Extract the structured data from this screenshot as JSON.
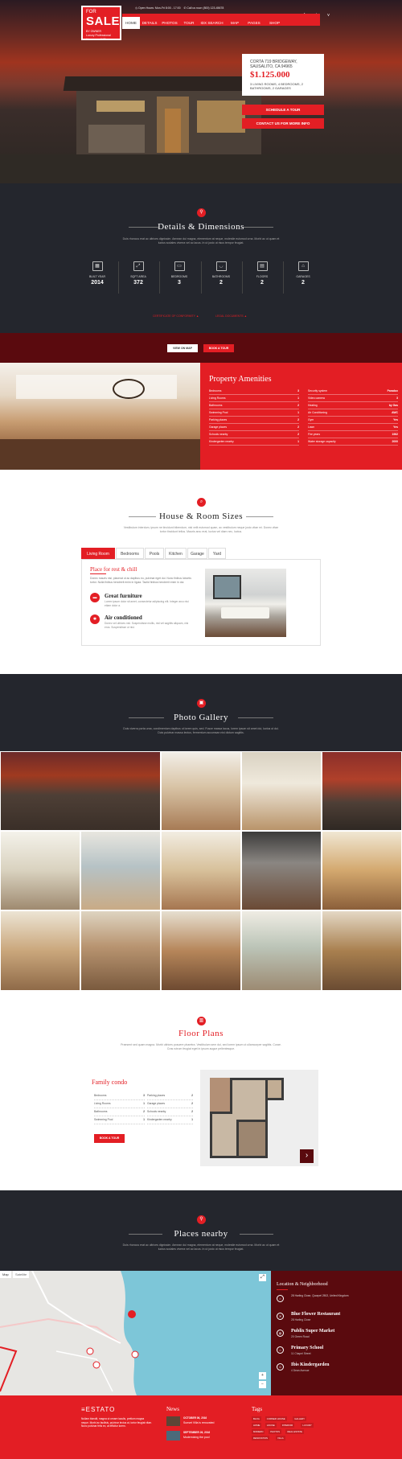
{
  "header": {
    "logo_small": "FOR",
    "logo_big": "SALE",
    "logo_sub": "BY OWNER",
    "logo_tagline": "Luxury Professional Houses and Villas",
    "open_hours": "Open Hours: Mon-Fri 8:00 - 17:00",
    "call_us": "Call us now: (800) 123-45678",
    "social_icons": [
      "facebook-icon",
      "twitter-icon",
      "vimeo-icon"
    ],
    "social_glyphs": [
      "f",
      "t",
      "v"
    ],
    "nav": [
      "HOME",
      "DETAILS",
      "PHOTOS",
      "TOUR",
      "IDX SEARCH",
      "MAP",
      "PAGES",
      "SHOP"
    ]
  },
  "hero": {
    "address": "CORTA 719 BRIDGEWAY, SAUSALITO, CA 94965",
    "price": "$1.125.000",
    "specs": "3 LIVING ROOMS, 4 BEDROOMS, 2 BATHROOMS, 2 GARAGES",
    "schedule_label": "SCHEDULE A TOUR",
    "contact_label": "CONTACT US FOR MORE INFO"
  },
  "details": {
    "title": "Details & Dimensions",
    "subtitle": "Duis rhoncus erat ac ultrices dignissim. Aenean dui magna, elementum at neque, molestie euismod urna. Morbi ac ut quam et luctus sodales viverra vel ac lacus. In ut justo ut risus tempor feugiat.",
    "stats": [
      {
        "label": "BUILT YEAR",
        "value": "2014",
        "icon": "calendar-icon",
        "glyph": "▦"
      },
      {
        "label": "SQFT AREA",
        "value": "372",
        "icon": "area-icon",
        "glyph": "⤢"
      },
      {
        "label": "BEDROOMS",
        "value": "3",
        "icon": "bed-icon",
        "glyph": "▭"
      },
      {
        "label": "BATHROOMS",
        "value": "2",
        "icon": "bath-icon",
        "glyph": "◡"
      },
      {
        "label": "FLOORS",
        "value": "2",
        "icon": "floors-icon",
        "glyph": "▤"
      },
      {
        "label": "GARAGES",
        "value": "2",
        "icon": "garage-icon",
        "glyph": "⌂"
      }
    ],
    "doc1": "CERTIFICATE OF CONFORMITY",
    "doc2": "LEGAL DOCUMENTS",
    "map_btn": "VIEW ON MAP",
    "tour_btn": "BOOK A TOUR"
  },
  "amenities": {
    "title": "Property Amenities",
    "left": [
      {
        "name": "Bedrooms",
        "value": "3"
      },
      {
        "name": "Living Rooms",
        "value": "1"
      },
      {
        "name": "Bathrooms",
        "value": "2"
      },
      {
        "name": "Swimming Pool",
        "value": "1"
      },
      {
        "name": "Parking places",
        "value": "2"
      },
      {
        "name": "Garage places",
        "value": "2"
      },
      {
        "name": "Schools nearby",
        "value": "2"
      },
      {
        "name": "Kindergarten nearby",
        "value": "1"
      }
    ],
    "right": [
      {
        "name": "Security system",
        "value": "Paradox"
      },
      {
        "name": "Video camera",
        "value": "3"
      },
      {
        "name": "Heating",
        "value": "by Gas"
      },
      {
        "name": "Air Conditioning",
        "value": "AWC"
      },
      {
        "name": "Gym",
        "value": "Yes"
      },
      {
        "name": "Lawn",
        "value": "Yes"
      },
      {
        "name": "Fire years",
        "value": "1962"
      },
      {
        "name": "Water storage capacity",
        "value": "2000"
      }
    ]
  },
  "rooms": {
    "title": "House & Room Sizes",
    "subtitle": "Vestibulum interdum, ipsum ne tincidunt bibendum, nisl velit euismod quam, ac vestibulum neque justo vitae mi. Donec vitae tortor tincidunt tellus. Mauris arcu erat, luctus vel diam nec, luctus.",
    "tabs": [
      "Living Room",
      "Bedrooms",
      "Pools",
      "Kitchen",
      "Garage",
      "Yard"
    ],
    "card_title": "Place for rest & chill",
    "card_text": "Donec mauris nisi, placerat ut ac dapibus eu, pulvinar eget dui. Nunc finibus lobortis tortor. Nulla finibus hendrerit enim in ligula. Tactid finibus hendrerit enim in dui.",
    "features": [
      {
        "title": "Great furniture",
        "text": "Lorem ipsum dolor sit amet, consectetur adipiscing elit. Integer arcu nisi etiam dolor a.",
        "icon": "sofa-icon",
        "glyph": "▬"
      },
      {
        "title": "Air conditioned",
        "text": "Donec vel ultrices nisl. Suspendisse mollis, nisl vel sagittis aliquam, nisi eros. Suspendisse ut nisl.",
        "icon": "snowflake-icon",
        "glyph": "✱"
      }
    ]
  },
  "gallery": {
    "title": "Photo Gallery",
    "subtitle": "Duis viverra porta urna, condimentum dapibus ut lorem quis, sed. Fusce massa lacus, lorem ipsum sit amet dui, luctus ut dui. Duis pulvinar massa lectus, fermentum accumsan nisi dictum sagittis."
  },
  "floor": {
    "title": "Floor Plans",
    "subtitle": "Praesent sed quam magna. Morbi ultrices posuere pharetra. Vestibulum sem dui, sed lorem ipsum ut ullamcorper sagittis. Curae. Cras rutrum feugiat eget in ipsum augue pellentesque.",
    "plan_title": "Family condo",
    "left": [
      {
        "name": "Bedrooms",
        "value": "3"
      },
      {
        "name": "Living Rooms",
        "value": "1"
      },
      {
        "name": "Bathrooms",
        "value": "2"
      },
      {
        "name": "Swimming Pool",
        "value": "1"
      }
    ],
    "right": [
      {
        "name": "Parking places",
        "value": "2"
      },
      {
        "name": "Garage places",
        "value": "2"
      },
      {
        "name": "Schools nearby",
        "value": "2"
      },
      {
        "name": "Kindergarten nearby",
        "value": "1"
      }
    ],
    "book_btn": "BOOK A TOUR",
    "next": "›"
  },
  "places": {
    "title": "Places nearby",
    "subtitle": "Duis rhoncus erat ac ultrices dignissim. Aenean dui magna, elementum at neque, molestie euismod urna. Morbi ac ut quam et luctus sodales viverra vel ac lacus. In ut justo ut risus tempor feugiat.",
    "map_tabs": [
      "Map",
      "Satellite"
    ],
    "loc_title": "Location & Neighborhood",
    "home_addr": "28 Harling Close, Quorpel 2502, United Kingdom",
    "items": [
      {
        "name": "Blue Flower Restaurant",
        "addr": "28 Harling Close",
        "icon": "restaurant-icon",
        "glyph": "✕"
      },
      {
        "name": "Publix Super Market",
        "addr": "20 Green Road",
        "icon": "cart-icon",
        "glyph": "◍"
      },
      {
        "name": "Primary School",
        "addr": "11 Chapel Street",
        "icon": "school-icon",
        "glyph": "⌂"
      },
      {
        "name": "Ibis Kindergarden",
        "addr": "4 Dean Avenue",
        "icon": "kindergarten-icon",
        "glyph": "☺"
      }
    ]
  },
  "footer": {
    "brand": "ESTATO",
    "about": "Nullam blandit, magna ut ornare iaculis, pretium magna neque. Morbi ac facilisis, pulvinar lectus at, tortor feugiat vitae. Nunc pulvinar felis ex, at efficitur lorem.",
    "news_title": "News",
    "news": [
      {
        "date": "OCTOBER 06, 2016",
        "title": "Sunset Villa is renovated"
      },
      {
        "date": "SEPTEMBER 26, 2016",
        "title": "Modernizing the pool"
      }
    ],
    "tags_title": "Tags",
    "tags": [
      "BLOG",
      "CORNER HOUSE",
      "GALLERY",
      "HOME",
      "HOUSE",
      "INTERIOR",
      "LUXURY",
      "MODERN",
      "PHOTOS",
      "REAL ESTATE",
      "RENOVATION",
      "VILLA"
    ]
  }
}
